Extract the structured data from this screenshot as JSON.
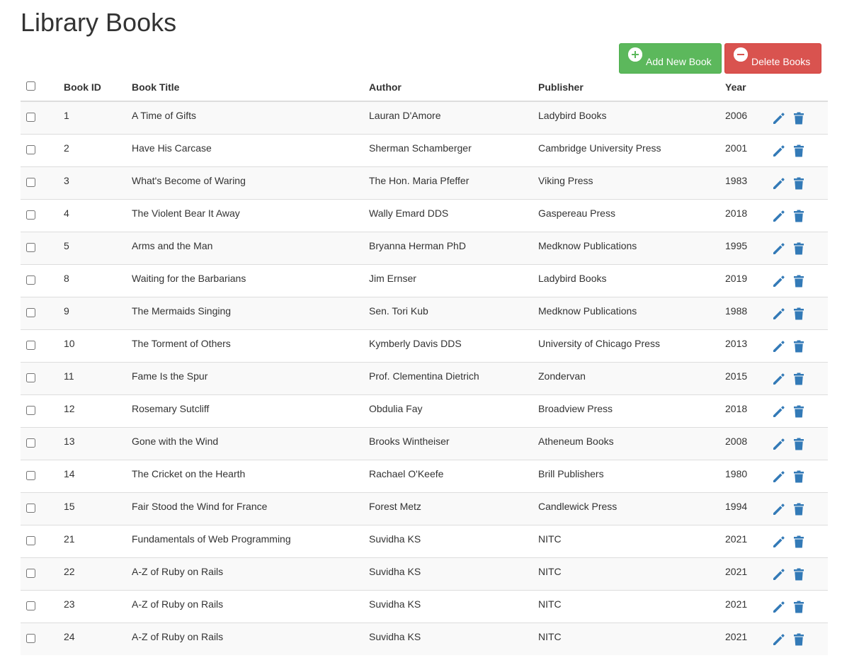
{
  "page": {
    "title": "Library Books"
  },
  "toolbar": {
    "add_label": "Add New Book",
    "delete_label": "Delete Books"
  },
  "colors": {
    "add_button": "#5cb85c",
    "delete_button": "#d9534f",
    "action_icon": "#337ab7"
  },
  "icons": {
    "add": "plus-circle-icon",
    "delete": "minus-circle-icon",
    "edit": "pencil-icon",
    "remove": "trash-icon"
  },
  "table": {
    "columns": [
      "Book ID",
      "Book Title",
      "Author",
      "Publisher",
      "Year"
    ],
    "rows": [
      {
        "id": "1",
        "title": "A Time of Gifts",
        "author": "Lauran D'Amore",
        "publisher": "Ladybird Books",
        "year": "2006"
      },
      {
        "id": "2",
        "title": "Have His Carcase",
        "author": "Sherman Schamberger",
        "publisher": "Cambridge University Press",
        "year": "2001"
      },
      {
        "id": "3",
        "title": "What's Become of Waring",
        "author": "The Hon. Maria Pfeffer",
        "publisher": "Viking Press",
        "year": "1983"
      },
      {
        "id": "4",
        "title": "The Violent Bear It Away",
        "author": "Wally Emard DDS",
        "publisher": "Gaspereau Press",
        "year": "2018"
      },
      {
        "id": "5",
        "title": "Arms and the Man",
        "author": "Bryanna Herman PhD",
        "publisher": "Medknow Publications",
        "year": "1995"
      },
      {
        "id": "8",
        "title": "Waiting for the Barbarians",
        "author": "Jim Ernser",
        "publisher": "Ladybird Books",
        "year": "2019"
      },
      {
        "id": "9",
        "title": "The Mermaids Singing",
        "author": "Sen. Tori Kub",
        "publisher": "Medknow Publications",
        "year": "1988"
      },
      {
        "id": "10",
        "title": "The Torment of Others",
        "author": "Kymberly Davis DDS",
        "publisher": "University of Chicago Press",
        "year": "2013"
      },
      {
        "id": "11",
        "title": "Fame Is the Spur",
        "author": "Prof. Clementina Dietrich",
        "publisher": "Zondervan",
        "year": "2015"
      },
      {
        "id": "12",
        "title": "Rosemary Sutcliff",
        "author": "Obdulia Fay",
        "publisher": "Broadview Press",
        "year": "2018"
      },
      {
        "id": "13",
        "title": "Gone with the Wind",
        "author": "Brooks Wintheiser",
        "publisher": "Atheneum Books",
        "year": "2008"
      },
      {
        "id": "14",
        "title": "The Cricket on the Hearth",
        "author": "Rachael O'Keefe",
        "publisher": "Brill Publishers",
        "year": "1980"
      },
      {
        "id": "15",
        "title": "Fair Stood the Wind for France",
        "author": "Forest Metz",
        "publisher": "Candlewick Press",
        "year": "1994"
      },
      {
        "id": "21",
        "title": "Fundamentals of Web Programming",
        "author": "Suvidha KS",
        "publisher": "NITC",
        "year": "2021"
      },
      {
        "id": "22",
        "title": "A-Z of Ruby on Rails",
        "author": "Suvidha KS",
        "publisher": "NITC",
        "year": "2021"
      },
      {
        "id": "23",
        "title": "A-Z of Ruby on Rails",
        "author": "Suvidha KS",
        "publisher": "NITC",
        "year": "2021"
      },
      {
        "id": "24",
        "title": "A-Z of Ruby on Rails",
        "author": "Suvidha KS",
        "publisher": "NITC",
        "year": "2021"
      }
    ]
  }
}
